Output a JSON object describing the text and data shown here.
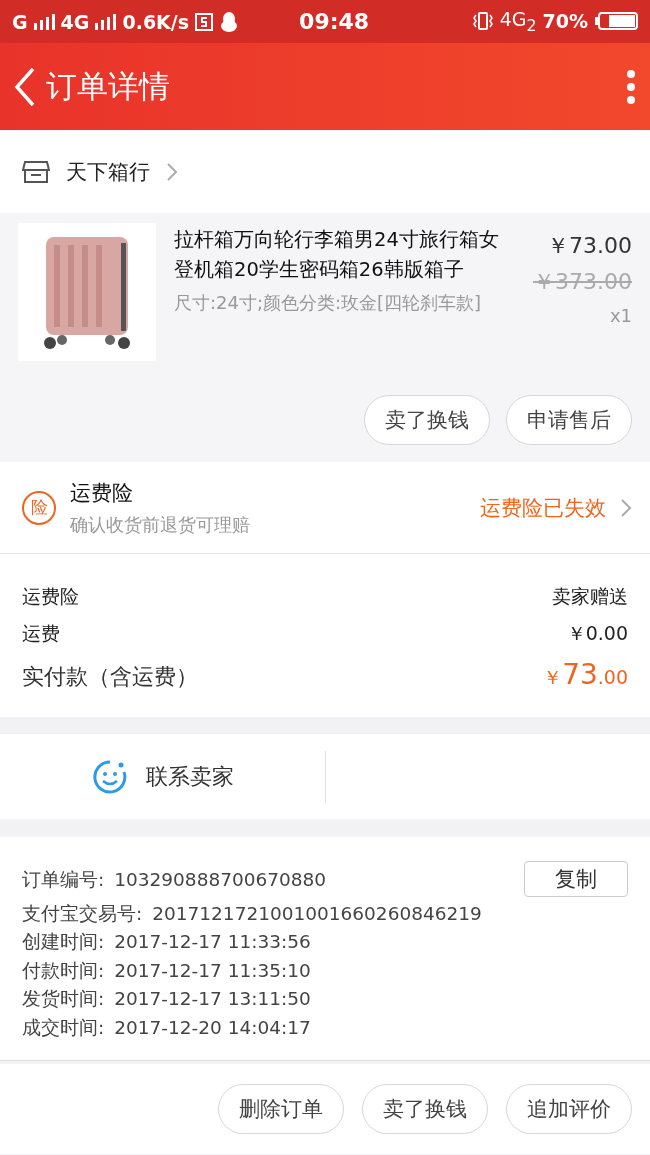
{
  "status_bar": {
    "signal_1": "G",
    "signal_2": "4G",
    "speed": "0.6K/s",
    "time": "09:48",
    "network": "4G$_{2}$",
    "battery": "70%"
  },
  "header": {
    "title": "订单详情"
  },
  "shop": {
    "name": "天下箱行"
  },
  "product": {
    "title": "拉杆箱万向轮行李箱男24寸旅行箱女登机箱20学生密码箱26韩版箱子",
    "sku": "尺寸:24寸;颜色分类:玫金[四轮刹车款]",
    "price": "￥73.00",
    "original_price": "￥373.00",
    "quantity": "x1",
    "buttons": [
      "卖了换钱",
      "申请售后"
    ]
  },
  "insurance": {
    "badge": "险",
    "name": "运费险",
    "description": "确认收货前退货可理赔",
    "status": "运费险已失效"
  },
  "fees": [
    {
      "label": "运费险",
      "value": "卖家赠送"
    },
    {
      "label": "运费",
      "value": "￥0.00"
    }
  ],
  "total": {
    "label": "实付款（含运费）",
    "value": "￥73.00"
  },
  "contact": {
    "label": "联系卖家"
  },
  "order_info": {
    "copy_button": "复制",
    "rows": [
      {
        "label": "订单编号:",
        "value": "103290888700670880"
      },
      {
        "label": "支付宝交易号:",
        "value": "2017121721001001660260846219"
      },
      {
        "label": "创建时间:",
        "value": "2017-12-17 11:33:56"
      },
      {
        "label": "付款时间:",
        "value": "2017-12-17 11:35:10"
      },
      {
        "label": "发货时间:",
        "value": "2017-12-17 13:11:50"
      },
      {
        "label": "成交时间:",
        "value": "2017-12-20 14:04:17"
      }
    ]
  },
  "actions": [
    "删除订单",
    "卖了换钱",
    "追加评价"
  ]
}
